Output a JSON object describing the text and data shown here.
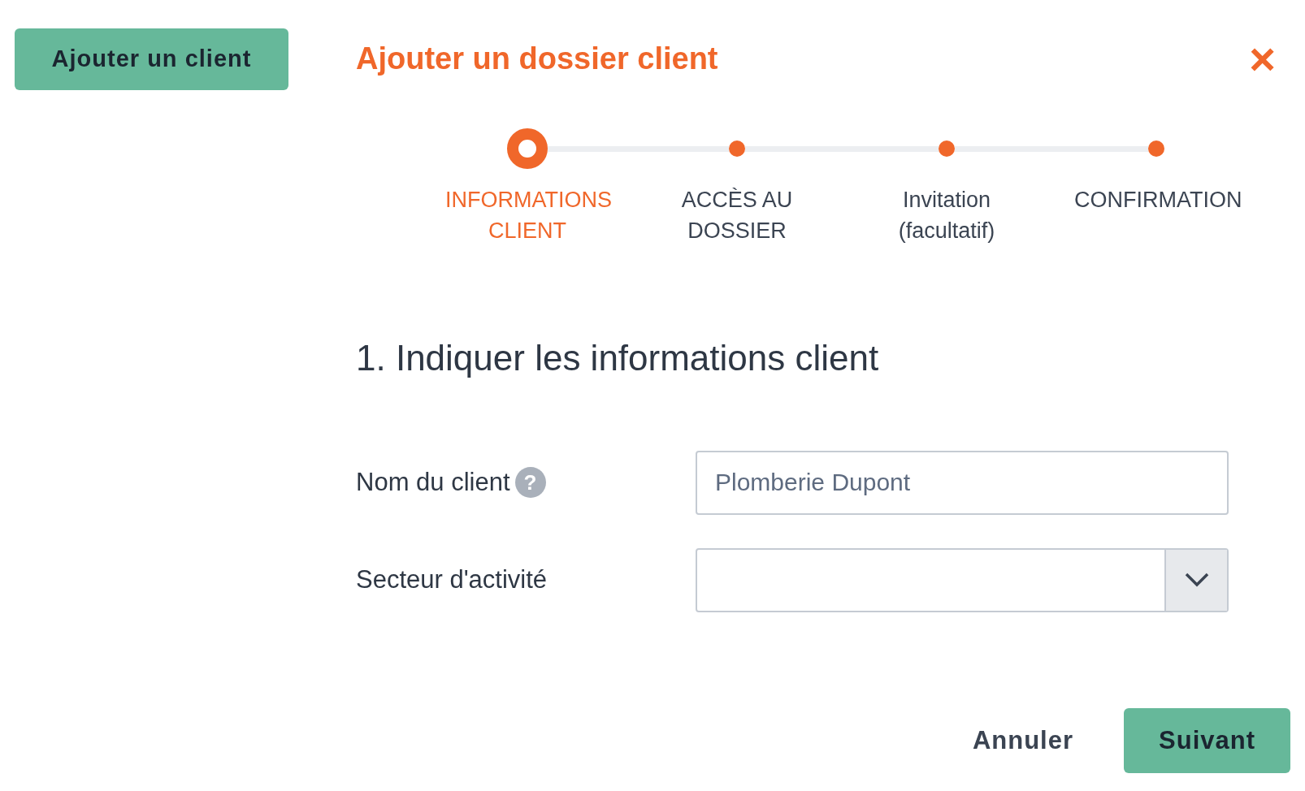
{
  "sidebar": {
    "add_button": "Ajouter un client"
  },
  "dialog": {
    "title": "Ajouter un dossier client",
    "close": "×",
    "steps": [
      {
        "label": "INFORMATIONS CLIENT",
        "selected": true
      },
      {
        "label": "ACCÈS AU DOSSIER",
        "selected": false
      },
      {
        "label": "Invitation (facultatif)",
        "selected": false
      },
      {
        "label": "CONFIRMATION",
        "selected": false
      }
    ],
    "heading": "1. Indiquer les informations client",
    "fields": [
      {
        "kind": "text",
        "label": "Nom du client",
        "help": "?",
        "placeholder": "Plomberie Dupont"
      },
      {
        "kind": "select",
        "label": "Secteur d'activité"
      }
    ],
    "buttons": [
      {
        "kind": "link",
        "label": "Annuler"
      },
      {
        "kind": "primary",
        "label": "Suivant"
      }
    ]
  }
}
